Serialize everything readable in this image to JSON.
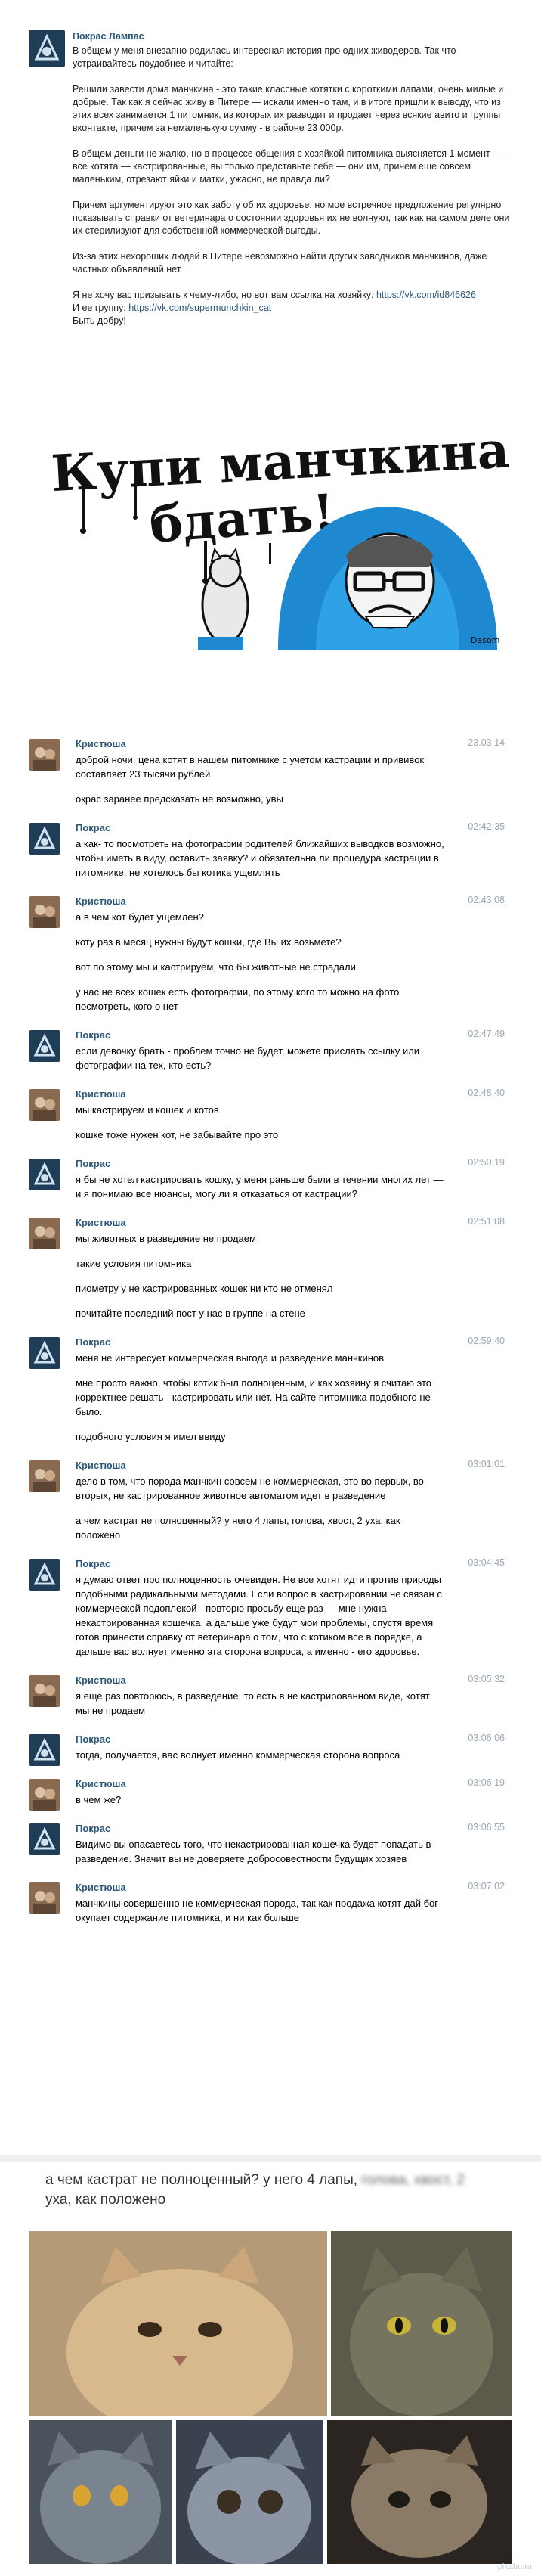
{
  "post": {
    "author": "Покрас Лампас",
    "paragraphs": [
      "В общем у меня внезапно родилась интересная история про одних живодеров. Так что устраивайтесь поудобнее и читайте:",
      "Решили завести дома манчкина - это такие классные котятки с короткими лапами, очень милые и добрые. Так как я сейчас живу в Питере — искали именно там, и в итоге пришли к выводу, что из этих всех занимается 1 питомник, из которых их разводит и продает через всякие авито и группы вконтакте, причем за немаленькую сумму - в районе 23 000р.",
      "В общем деньги не жалко, но в процессе общения с хозяйкой питомника выясняется 1 момент — все котята — кастрированные, вы только представьте себе — они им, причем еще совсем маленьким, отрезают яйки и матки, ужасно, не правда ли?",
      "Причем аргументируют это как заботу об их здоровье, но мое встречное предложение регулярно показывать справки от ветеринара о состоянии здоровья их не волнуют, так как на самом деле они их стерилизуют для собственной коммерческой выгоды.",
      "Из-за этих нехороших людей в Питере невозможно найти других заводчиков манчкинов, даже частных объявлений нет."
    ],
    "contact_line": "Я не хочу вас призывать к чему-либо, но вот вам ссылка на хозяйку:",
    "contact_link": "https://vk.com/id846626",
    "group_line": "И ее группу:",
    "group_link": "https://vk.com/supermunchkin_cat",
    "signoff": "Быть добру!"
  },
  "poster": {
    "headline_1": "Купи манчкина",
    "headline_2": "бдать!",
    "signature": "Dasom"
  },
  "chat": [
    {
      "author": "Кристюша",
      "time": "23.03.14",
      "avatar": "cat",
      "lines": [
        "доброй ночи, цена котят в нашем питомнике с учетом кастрации и прививок составляет 23 тысячи рублей",
        "окрас заранее предсказать не возможно, увы"
      ]
    },
    {
      "author": "Покрас",
      "time": "02:42:35",
      "avatar": "logo",
      "lines": [
        "а как- то посмотреть на фотографии родителей ближайших выводков возможно, чтобы иметь в виду, оставить заявку? и обязательна ли процедура кастрации в питомнике, не хотелось бы котика ущемлять"
      ]
    },
    {
      "author": "Кристюша",
      "time": "02:43:08",
      "avatar": "cat",
      "lines": [
        "а в чем кот будет ущемлен?",
        "коту раз в месяц нужны будут кошки, где Вы их возьмете?",
        "вот по этому мы и кастрируем, что бы животные не страдали",
        "у нас не всех кошек есть фотографии, по этому кого то можно на фото посмотреть, кого о нет"
      ]
    },
    {
      "author": "Покрас",
      "time": "02:47:49",
      "avatar": "logo",
      "lines": [
        "если девочку брать - проблем точно не будет, можете прислать ссылку или фотографии на тех, кто есть?"
      ]
    },
    {
      "author": "Кристюша",
      "time": "02:48:40",
      "avatar": "cat",
      "lines": [
        "мы кастрируем и кошек и котов",
        "кошке тоже нужен кот, не забывайте про это"
      ]
    },
    {
      "author": "Покрас",
      "time": "02:50:19",
      "avatar": "logo",
      "lines": [
        "я бы не хотел кастрировать кошку, у меня раньше были в течении многих лет — и я понимаю все нюансы, могу ли я отказаться от кастрации?"
      ]
    },
    {
      "author": "Кристюша",
      "time": "02:51:08",
      "avatar": "cat",
      "lines": [
        "мы животных в разведение не продаем",
        "такие условия питомника",
        "пиометру у не кастрированных кошек ни кто не отменял",
        "почитайте последний пост у нас в группе на стене"
      ]
    },
    {
      "author": "Покрас",
      "time": "02:59:40",
      "avatar": "logo",
      "lines": [
        "меня не интересует коммерческая выгода и разведение манчкинов",
        "мне просто важно, чтобы котик был полноценным, и как хозяину я считаю это корректнее решать - кастрировать или нет. На сайте питомника подобного не было.",
        "подобного условия я имел ввиду"
      ]
    },
    {
      "author": "Кристюша",
      "time": "03:01:01",
      "avatar": "cat",
      "lines": [
        "дело в том, что порода манчкин совсем не коммерческая, это во первых, во вторых, не кастрированное животное автоматом идет в разведение",
        "а чем кастрат не полноценный? у него 4 лапы, голова, хвост, 2 уха, как положено"
      ]
    },
    {
      "author": "Покрас",
      "time": "03:04:45",
      "avatar": "logo",
      "lines": [
        "я думаю ответ про полноценность очевиден. Не все хотят идти против природы подобными радикальными методами. Если вопрос в кастрировании не связан с коммерческой подоплекой - повторю просьбу еще раз — мне нужна некастрированная кошечка, а дальше уже будут мои проблемы, спустя время готов принести справку от ветеринара о том, что с котиком все в порядке, а дальше вас волнует именно эта сторона вопроса, а именно - его здоровье."
      ]
    },
    {
      "author": "Кристюша",
      "time": "03:05:32",
      "avatar": "cat",
      "lines": [
        "я еще раз повторюсь, в разведение, то есть в не кастрированном виде, котят мы не продаем"
      ]
    },
    {
      "author": "Покрас",
      "time": "03:06:06",
      "avatar": "logo",
      "lines": [
        "тогда, получается, вас волнует именно коммерческая сторона вопроса"
      ]
    },
    {
      "author": "Кристюша",
      "time": "03:06:19",
      "avatar": "cat",
      "lines": [
        "в чем же?"
      ]
    },
    {
      "author": "Покрас",
      "time": "03:06:55",
      "avatar": "logo",
      "lines": [
        "Видимо вы опасаетесь того, что некастрированная кошечка будет попадать в разведение. Значит вы не доверяете добросовестности будущих хозяев"
      ]
    },
    {
      "author": "Кристюша",
      "time": "03:07:02",
      "avatar": "cat",
      "lines": [
        "манчкины совершенно не коммерческая порода, так как продажа котят дай бог окупает содержание питомника, и ни как больше"
      ]
    }
  ],
  "collage": {
    "quote_clear": "а чем кастрат не полноценный? у него 4 лапы,",
    "quote_blur": "голова, хвост, 2",
    "quote_end": "уха, как положено",
    "watermark": "pikabu.ru"
  }
}
